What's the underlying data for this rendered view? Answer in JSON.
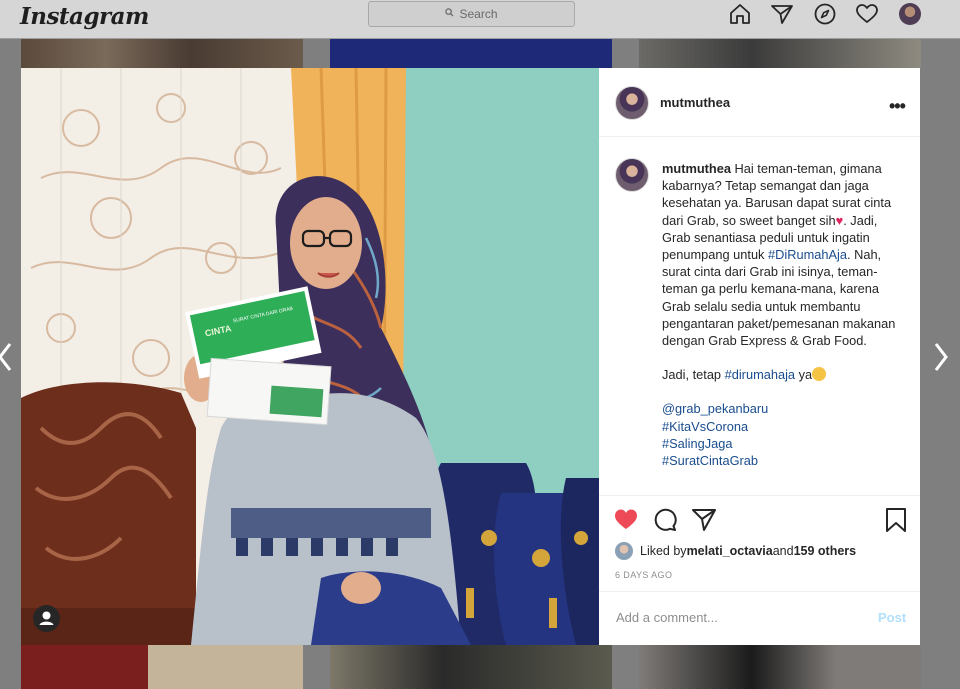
{
  "app": {
    "title": "Instagram"
  },
  "search": {
    "placeholder": "Search"
  },
  "nav": {
    "icons": [
      "home-icon",
      "direct-icon",
      "explore-icon",
      "activity-heart-icon",
      "profile-avatar"
    ]
  },
  "post": {
    "username": "mutmuthea",
    "caption": {
      "username": "mutmuthea",
      "line1": "Hai teman-teman, gimana kabarnya? Tetap semangat dan jaga kesehatan ya. Barusan dapat surat cinta dari Grab, so sweet banget sih",
      "line1b": ". Jadi, Grab senantiasa peduli untuk ingatin penumpang untuk ",
      "hashtag1": "#DiRumahAja",
      "line1c": ". Nah, surat cinta dari Grab ini isinya, teman-teman ga perlu kemana-mana, karena Grab selalu sedia untuk membantu pengantaran paket/pemesanan makanan dengan Grab Express & Grab Food.",
      "line2a": "Jadi, tetap ",
      "hashtag2": "#dirumahaja",
      "line2b": " ya",
      "mention": "@grab_pekanbaru",
      "tags": [
        "#KitaVsCorona",
        "#SalingJaga",
        "#SuratCintaGrab"
      ]
    },
    "likes": {
      "prefix": "Liked by ",
      "user": "melati_octavia",
      "middle": " and ",
      "count": "159 others"
    },
    "time_ago": "6 DAYS AGO",
    "comment": {
      "placeholder": "Add a comment...",
      "post_label": "Post"
    },
    "colors": {
      "like_red": "#ed4956",
      "link_blue": "#1a4d8f",
      "post_disabled": "#b2dffc"
    },
    "photo": {
      "envelope_text_1": "SURAT CINTA DARI GRAB",
      "envelope_text_2": "CINTA"
    }
  }
}
